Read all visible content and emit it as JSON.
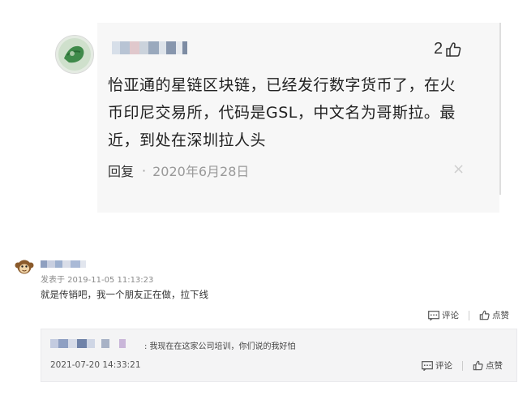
{
  "top_comment": {
    "likes": "2",
    "content": "怡亚通的星链区块链，已经发行数字货币了，在火币印尼交易所，代码是GSL，中文名为哥斯拉。最近，到处在深圳拉人头",
    "reply_label": "回复",
    "dot": "·",
    "date": "2020年6月28日",
    "close": "×"
  },
  "second_comment": {
    "date": "发表于 2019-11-05 11:13:23",
    "content": "就是传销吧，我一个朋友正在做，拉下线",
    "actions": {
      "comment_label": "评论",
      "like_label": "点赞"
    }
  },
  "reply": {
    "text": ": 我现在在这家公司培训，你们说的我好怕",
    "date": "2021-07-20 14:33:21",
    "actions": {
      "comment_label": "评论",
      "like_label": "点赞"
    }
  }
}
